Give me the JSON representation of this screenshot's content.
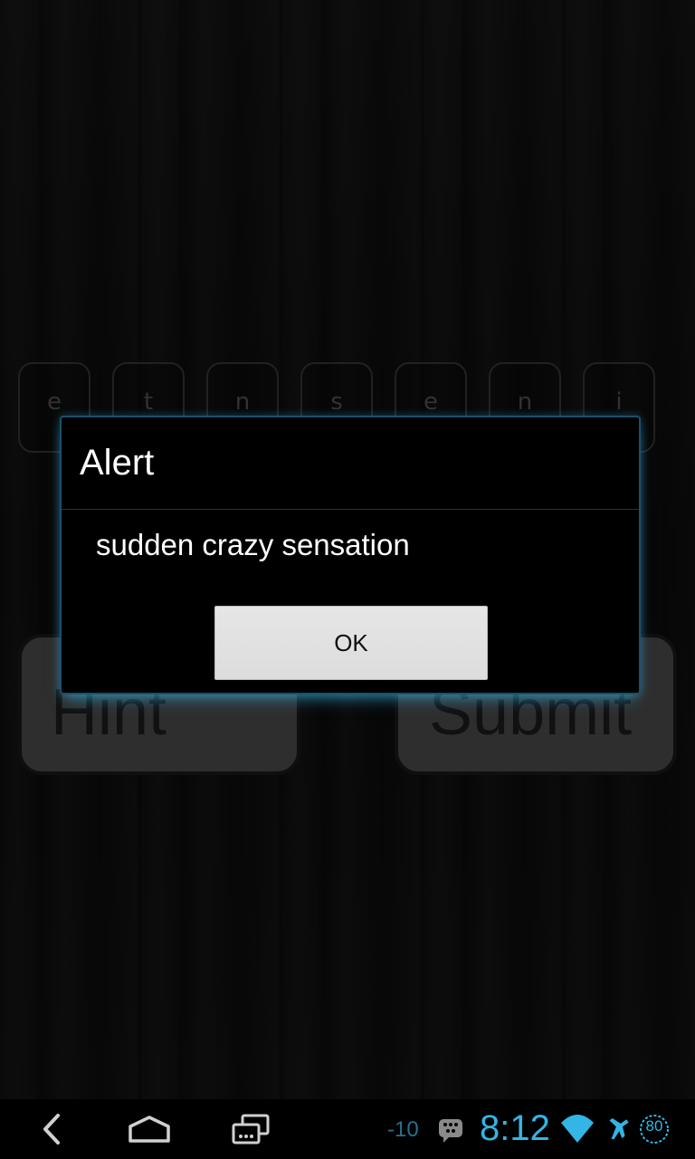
{
  "tiles": [
    "e",
    "t",
    "n",
    "s",
    "e",
    "n",
    "i"
  ],
  "buttons": {
    "hint_label": "Hint",
    "submit_label": "Submit"
  },
  "dialog": {
    "title": "Alert",
    "message": "sudden crazy sensation",
    "ok_label": "OK"
  },
  "status_bar": {
    "time": "8:12",
    "signal_value": "-10",
    "battery_level": "80",
    "accent_color": "#33b5e5",
    "icons": [
      "back-icon",
      "home-icon",
      "recent-apps-icon",
      "bbm-icon",
      "wifi-icon",
      "airplane-mode-icon",
      "battery-icon"
    ]
  }
}
